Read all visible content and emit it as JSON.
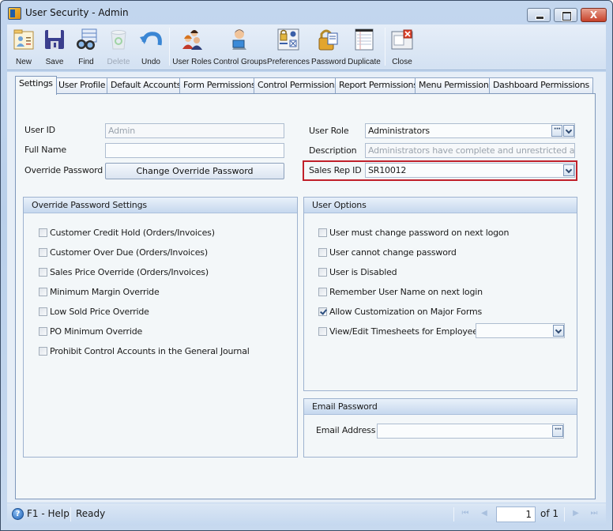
{
  "window": {
    "title": "User Security - Admin",
    "close_glyph": "X"
  },
  "toolbar": {
    "buttons": [
      {
        "id": "new",
        "label": "New",
        "icon": "new-record-icon",
        "enabled": true
      },
      {
        "id": "save",
        "label": "Save",
        "icon": "floppy-disk-icon",
        "enabled": true
      },
      {
        "id": "find",
        "label": "Find",
        "icon": "binoculars-icon",
        "enabled": true
      },
      {
        "id": "delete",
        "label": "Delete",
        "icon": "recycle-bin-icon",
        "enabled": false
      },
      {
        "id": "undo",
        "label": "Undo",
        "icon": "undo-arrow-icon",
        "enabled": true
      },
      {
        "id": "user-roles",
        "label": "User Roles",
        "icon": "users-group-icon",
        "enabled": true
      },
      {
        "id": "control-groups",
        "label": "Control Groups",
        "icon": "user-computer-icon",
        "enabled": true
      },
      {
        "id": "preferences",
        "label": "Preferences",
        "icon": "preferences-lock-icon",
        "enabled": true
      },
      {
        "id": "password",
        "label": "Password",
        "icon": "padlock-key-icon",
        "enabled": true
      },
      {
        "id": "duplicate",
        "label": "Duplicate",
        "icon": "duplicate-pages-icon",
        "enabled": true
      },
      {
        "id": "close",
        "label": "Close",
        "icon": "close-window-icon",
        "enabled": true
      }
    ]
  },
  "tabs": [
    {
      "label": "Settings",
      "active": true
    },
    {
      "label": "User Profile",
      "active": false
    },
    {
      "label": "Default Accounts",
      "active": false
    },
    {
      "label": "Form Permissions",
      "active": false
    },
    {
      "label": "Control Permissions",
      "active": false
    },
    {
      "label": "Report Permissions",
      "active": false
    },
    {
      "label": "Menu Permissions",
      "active": false
    },
    {
      "label": "Dashboard Permissions",
      "active": false
    }
  ],
  "settings": {
    "user_id": {
      "label": "User ID",
      "value": "Admin"
    },
    "full_name": {
      "label": "Full Name",
      "value": ""
    },
    "override_password": {
      "label": "Override Password",
      "button": "Change Override Password"
    },
    "user_role": {
      "label": "User Role",
      "value": "Administrators"
    },
    "description": {
      "label": "Description",
      "value": "Administrators have complete and unrestricted access"
    },
    "sales_rep_id": {
      "label": "Sales Rep ID",
      "value": "SR10012"
    },
    "ellipsis": "···"
  },
  "override_group": {
    "title": "Override Password Settings",
    "items": [
      {
        "label": "Customer Credit Hold (Orders/Invoices)",
        "checked": false
      },
      {
        "label": "Customer Over Due (Orders/Invoices)",
        "checked": false
      },
      {
        "label": "Sales Price Override (Orders/Invoices)",
        "checked": false
      },
      {
        "label": "Minimum Margin Override",
        "checked": false
      },
      {
        "label": "Low Sold Price Override",
        "checked": false
      },
      {
        "label": "PO Minimum Override",
        "checked": false
      },
      {
        "label": "Prohibit Control Accounts in the General Journal",
        "checked": false
      }
    ]
  },
  "user_options": {
    "title": "User Options",
    "items": [
      {
        "label": "User must change password on next logon",
        "checked": false
      },
      {
        "label": "User cannot change password",
        "checked": false
      },
      {
        "label": "User is Disabled",
        "checked": false
      },
      {
        "label": "Remember User Name on next login",
        "checked": false
      },
      {
        "label": "Allow Customization on Major Forms",
        "checked": true
      },
      {
        "label": "View/Edit Timesheets for Employee",
        "checked": false
      }
    ],
    "employee_value": ""
  },
  "email_password": {
    "title": "Email Password",
    "email_label": "Email Address",
    "email_value": ""
  },
  "statusbar": {
    "help": "F1 - Help",
    "help_glyph": "?",
    "status": "Ready",
    "page_current": "1",
    "page_of": "of 1",
    "nav": {
      "first": "⏮",
      "prev": "◀",
      "next": "▶",
      "last": "⏭"
    }
  }
}
